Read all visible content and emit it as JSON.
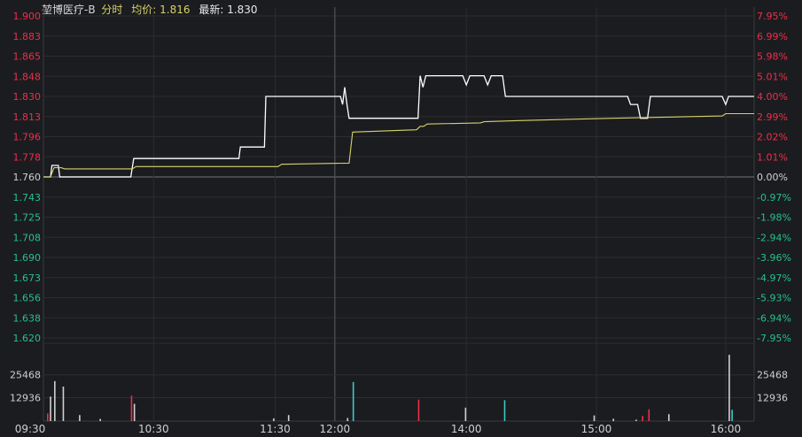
{
  "header": {
    "name": "堃博医疗-B",
    "mode": "分时",
    "avg_label": "均价:",
    "avg_value": "1.816",
    "last_label": "最新:",
    "last_value": "1.830"
  },
  "colors": {
    "background": "#1b1c1f",
    "grid": "#2c2d31",
    "price_line": "#ffffff",
    "avg_line": "#d7d26a",
    "up": "#ee2e4b",
    "down": "#27c08a",
    "neutral": "#d0d0d0",
    "cyan": "#3fc7c4"
  },
  "chart_data": {
    "type": "line",
    "price_axis": {
      "ylim": [
        1.62,
        1.9
      ],
      "reference": 1.76,
      "left_labels": [
        "1.900",
        "1.883",
        "1.865",
        "1.848",
        "1.830",
        "1.813",
        "1.796",
        "1.778",
        "1.760",
        "1.743",
        "1.725",
        "1.708",
        "1.690",
        "1.673",
        "1.656",
        "1.638",
        "1.620"
      ],
      "right_labels": [
        "7.95%",
        "6.99%",
        "5.98%",
        "5.01%",
        "4.00%",
        "2.99%",
        "2.02%",
        "1.01%",
        "0.00%",
        "-0.97%",
        "-1.98%",
        "-2.94%",
        "-3.96%",
        "-4.97%",
        "-5.93%",
        "-6.94%",
        "-7.95%"
      ]
    },
    "volume_axis": {
      "ylim": [
        0,
        38000
      ],
      "labels": [
        "25468",
        "12936"
      ],
      "label_values": [
        25468,
        12936
      ]
    },
    "x_axis": {
      "range": [
        0,
        100
      ],
      "ticks": [
        {
          "label": "09:30",
          "x": 0
        },
        {
          "label": "10:30",
          "x": 15.5
        },
        {
          "label": "11:30",
          "x": 32.6
        },
        {
          "label": "12:00",
          "x": 41.0
        },
        {
          "label": "14:00",
          "x": 59.5
        },
        {
          "label": "15:00",
          "x": 77.8
        },
        {
          "label": "16:00",
          "x": 96.0
        }
      ]
    },
    "series": [
      {
        "role": "price",
        "points": [
          [
            0,
            1.76
          ],
          [
            1.0,
            1.76
          ],
          [
            1.2,
            1.77
          ],
          [
            2.1,
            1.77
          ],
          [
            2.3,
            1.76
          ],
          [
            12.3,
            1.76
          ],
          [
            12.7,
            1.776
          ],
          [
            27.5,
            1.776
          ],
          [
            27.7,
            1.786
          ],
          [
            31.1,
            1.786
          ],
          [
            31.3,
            1.83
          ],
          [
            41.8,
            1.83
          ],
          [
            42.1,
            1.823
          ],
          [
            42.4,
            1.838
          ],
          [
            42.7,
            1.823
          ],
          [
            43.0,
            1.811
          ],
          [
            52.7,
            1.811
          ],
          [
            53.0,
            1.848
          ],
          [
            53.4,
            1.838
          ],
          [
            53.8,
            1.848
          ],
          [
            59.0,
            1.848
          ],
          [
            59.5,
            1.84
          ],
          [
            60.0,
            1.848
          ],
          [
            62.0,
            1.848
          ],
          [
            62.5,
            1.84
          ],
          [
            63.0,
            1.848
          ],
          [
            64.6,
            1.848
          ],
          [
            65.0,
            1.83
          ],
          [
            82.2,
            1.83
          ],
          [
            82.6,
            1.823
          ],
          [
            83.6,
            1.823
          ],
          [
            84.0,
            1.811
          ],
          [
            85.0,
            1.811
          ],
          [
            85.4,
            1.83
          ],
          [
            95.5,
            1.83
          ],
          [
            96.0,
            1.823
          ],
          [
            96.4,
            1.83
          ],
          [
            100,
            1.83
          ]
        ]
      },
      {
        "role": "average",
        "points": [
          [
            0,
            1.76
          ],
          [
            1.0,
            1.76
          ],
          [
            1.5,
            1.768
          ],
          [
            2.5,
            1.768
          ],
          [
            3.0,
            1.767
          ],
          [
            12.5,
            1.767
          ],
          [
            13.0,
            1.769
          ],
          [
            33.0,
            1.769
          ],
          [
            33.5,
            1.771
          ],
          [
            43.0,
            1.772
          ],
          [
            43.5,
            1.799
          ],
          [
            52.5,
            1.801
          ],
          [
            53.0,
            1.804
          ],
          [
            53.5,
            1.804
          ],
          [
            54.0,
            1.806
          ],
          [
            61.5,
            1.807
          ],
          [
            62.0,
            1.808
          ],
          [
            67.0,
            1.809
          ],
          [
            80.0,
            1.811
          ],
          [
            95.5,
            1.813
          ],
          [
            96.0,
            1.815
          ],
          [
            100,
            1.815
          ]
        ]
      }
    ],
    "volume": [
      {
        "x": 0.6,
        "v": 4200,
        "c": "up"
      },
      {
        "x": 1.0,
        "v": 13500,
        "c": "neutral"
      },
      {
        "x": 1.6,
        "v": 22000,
        "c": "neutral"
      },
      {
        "x": 2.8,
        "v": 19000,
        "c": "neutral"
      },
      {
        "x": 5.1,
        "v": 3300,
        "c": "neutral"
      },
      {
        "x": 8.0,
        "v": 1200,
        "c": "neutral"
      },
      {
        "x": 12.4,
        "v": 14000,
        "c": "up"
      },
      {
        "x": 12.8,
        "v": 9500,
        "c": "neutral"
      },
      {
        "x": 32.4,
        "v": 1500,
        "c": "neutral"
      },
      {
        "x": 34.5,
        "v": 3300,
        "c": "neutral"
      },
      {
        "x": 42.8,
        "v": 1700,
        "c": "neutral"
      },
      {
        "x": 43.6,
        "v": 21500,
        "c": "cyan"
      },
      {
        "x": 52.8,
        "v": 11800,
        "c": "up"
      },
      {
        "x": 59.4,
        "v": 7400,
        "c": "neutral"
      },
      {
        "x": 64.9,
        "v": 11500,
        "c": "cyan"
      },
      {
        "x": 77.5,
        "v": 3100,
        "c": "neutral"
      },
      {
        "x": 80.2,
        "v": 1300,
        "c": "neutral"
      },
      {
        "x": 83.4,
        "v": 800,
        "c": "neutral"
      },
      {
        "x": 84.3,
        "v": 2800,
        "c": "up"
      },
      {
        "x": 85.2,
        "v": 6500,
        "c": "up"
      },
      {
        "x": 88.0,
        "v": 3800,
        "c": "neutral"
      },
      {
        "x": 96.5,
        "v": 36500,
        "c": "neutral"
      },
      {
        "x": 96.9,
        "v": 6200,
        "c": "cyan"
      }
    ]
  }
}
